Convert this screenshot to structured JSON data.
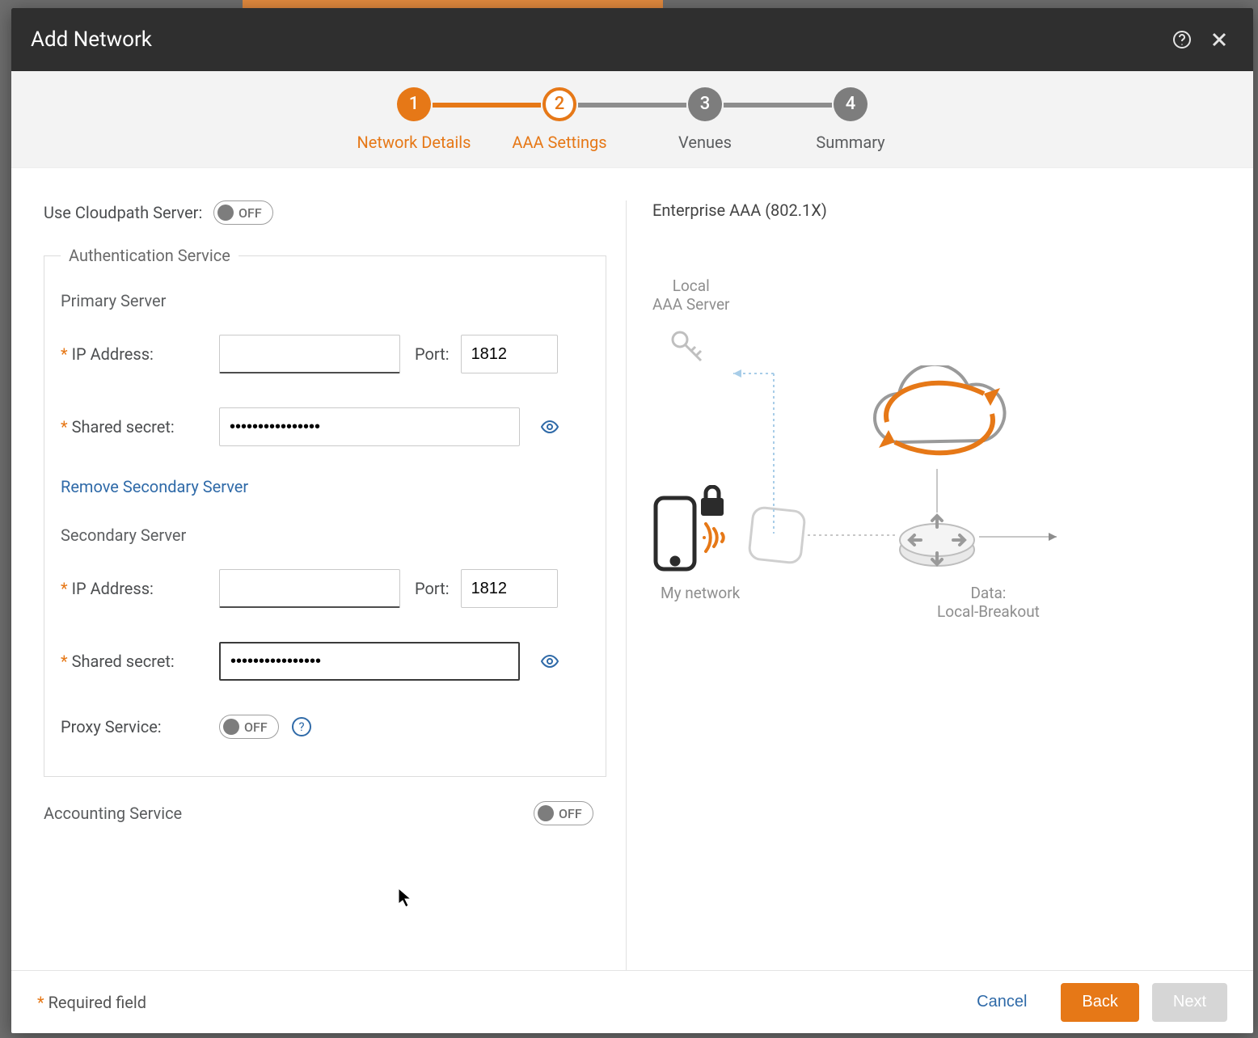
{
  "modal": {
    "title": "Add Network"
  },
  "stepper": {
    "steps": [
      {
        "num": "1",
        "label": "Network Details"
      },
      {
        "num": "2",
        "label": "AAA Settings"
      },
      {
        "num": "3",
        "label": "Venues"
      },
      {
        "num": "4",
        "label": "Summary"
      }
    ]
  },
  "left": {
    "cloudpath_label": "Use Cloudpath Server:",
    "toggle_off": "OFF",
    "auth_fieldset_title": "Authentication Service",
    "primary_header": "Primary Server",
    "secondary_header": "Secondary Server",
    "ip_label": "IP Address:",
    "port_label": "Port:",
    "port_value": "1812",
    "secret_label": "Shared secret:",
    "secret_mask": "••••••••••••••••",
    "remove_secondary": "Remove Secondary Server",
    "proxy_label": "Proxy Service:",
    "accounting_label": "Accounting Service"
  },
  "right": {
    "title": "Enterprise AAA (802.1X)",
    "label_local": "Local\nAAA Server",
    "label_network": "My network",
    "label_data": "Data:\nLocal-Breakout"
  },
  "footer": {
    "required_note": "Required field",
    "cancel": "Cancel",
    "back": "Back",
    "next": "Next"
  }
}
